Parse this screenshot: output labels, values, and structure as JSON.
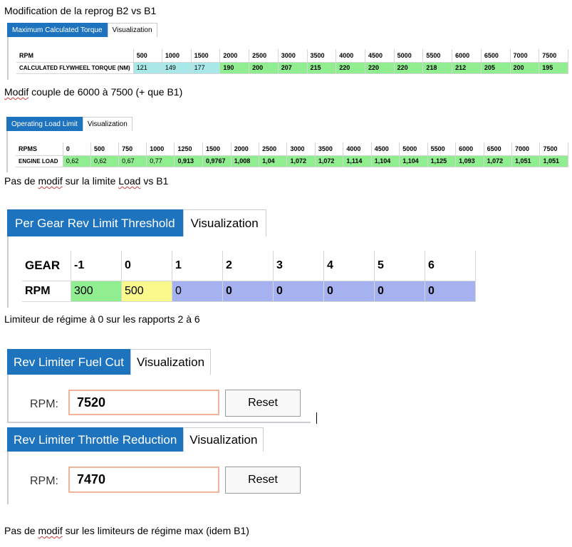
{
  "captions": {
    "title": "Modification de la reprog B2 vs B1",
    "c1": "Modif couple de 6000 à 7500 (+ que B1)",
    "c2": "Pas de modif sur la limite Load vs B1",
    "c3": "Limiteur de régime à 0 sur les rapports 2 à 6",
    "c4": "Pas de modif sur les limiteurs de régime max (idem B1)"
  },
  "torque": {
    "tab_active": "Maximum Calculated Torque",
    "tab_other": "Visualization",
    "row_header": "RPM",
    "rpm": [
      "500",
      "1000",
      "1500",
      "2000",
      "2500",
      "3000",
      "3500",
      "4000",
      "4500",
      "5000",
      "5500",
      "6000",
      "6500",
      "7000",
      "7500"
    ],
    "value_label": "CALCULATED FLYWHEEL TORQUE (NM)",
    "values": [
      "121",
      "149",
      "177",
      "190",
      "200",
      "207",
      "215",
      "220",
      "220",
      "220",
      "218",
      "212",
      "205",
      "200",
      "195"
    ]
  },
  "load": {
    "tab_active": "Operating Load Limit",
    "tab_other": "Visualization",
    "row_header": "RPMS",
    "rpm": [
      "0",
      "500",
      "750",
      "1000",
      "1250",
      "1500",
      "2000",
      "2500",
      "3000",
      "3500",
      "4000",
      "4500",
      "5000",
      "5500",
      "6000",
      "6500",
      "7000",
      "7500"
    ],
    "value_label": "ENGINE LOAD",
    "values": [
      "0,62",
      "0,62",
      "0,67",
      "0,77",
      "0,913",
      "0,9767",
      "1,008",
      "1,04",
      "1,072",
      "1,072",
      "1,114",
      "1,104",
      "1,104",
      "1,125",
      "1,093",
      "1,072",
      "1,051",
      "1,051"
    ]
  },
  "gear": {
    "tab_active": "Per Gear Rev Limit Threshold",
    "tab_other": "Visualization",
    "row_header": "GEAR",
    "gears": [
      "-1",
      "0",
      "1",
      "2",
      "3",
      "4",
      "5",
      "6"
    ],
    "value_label": "RPM",
    "values": [
      "300",
      "500",
      "0",
      "0",
      "0",
      "0",
      "0",
      "0"
    ]
  },
  "fuelcut": {
    "tab_active": "Rev Limiter Fuel Cut",
    "tab_other": "Visualization",
    "rpm_label": "RPM:",
    "rpm_value": "7520",
    "reset_label": "Reset"
  },
  "throttle": {
    "tab_active": "Rev Limiter Throttle Reduction",
    "tab_other": "Visualization",
    "rpm_label": "RPM:",
    "rpm_value": "7470",
    "reset_label": "Reset"
  },
  "colors": {
    "tab_blue": "#1e73be",
    "green": "#90ee90",
    "cyan": "#a8e8e8",
    "yellow": "#fafa8c",
    "blue": "#a6b2f0"
  }
}
